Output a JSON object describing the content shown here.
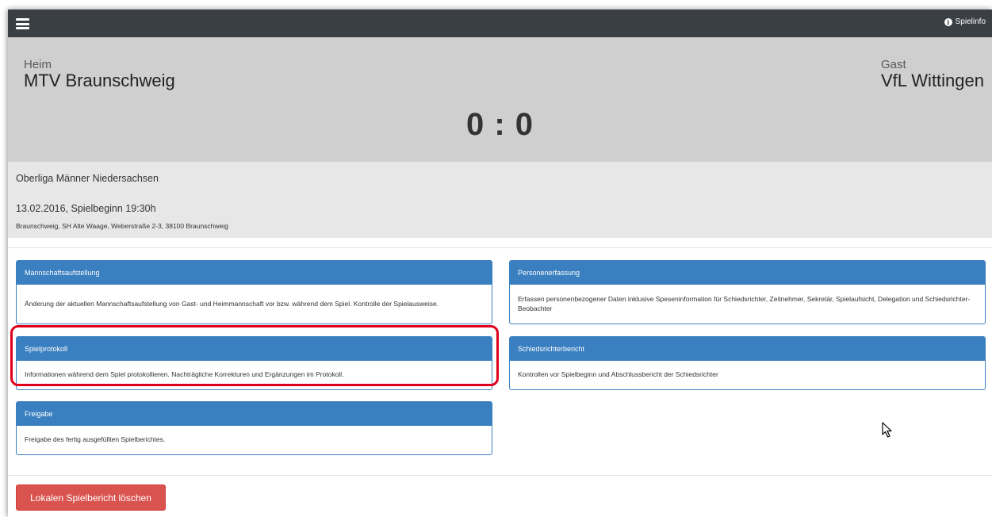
{
  "navbar": {
    "info_label": "Spielinfo",
    "menu_icon": "hamburger-menu-icon",
    "info_icon": "info-circle-icon"
  },
  "match": {
    "home_role": "Heim",
    "home_team": "MTV Braunschweig",
    "guest_role": "Gast",
    "guest_team": "VfL Wittingen",
    "score": "0 : 0"
  },
  "game_info": {
    "league": "Oberliga Männer Niedersachsen",
    "date_time": "13.02.2016, Spielbeginn 19:30h",
    "venue": "Braunschweig, SH Alte Waage, Weberstraße 2-3, 38100 Braunschweig"
  },
  "panels": [
    {
      "title": "Mannschaftsaufstellung",
      "description": "Änderung der aktuellen Mannschaftsaufstellung von Gast- und Heimmannschaft vor bzw. während dem Spiel. Kontrolle der Spielausweise."
    },
    {
      "title": "Personenerfassung",
      "description": "Erfassen personenbezogener Daten inklusive Speseninformation für Schiedsrichter, Zeitnehmer, Sekretär, Spielaufsicht, Delegation und Schiedsrichter-Beobachter"
    },
    {
      "title": "Spielprotokoll",
      "description": "Informationen während dem Spiel protokollieren. Nachträgliche Korrekturen und Ergänzungen im Protokoll."
    },
    {
      "title": "Schiedsrichterbericht",
      "description": "Kontrollen vor Spielbeginn und Abschlussbericht der Schiedsrichter"
    },
    {
      "title": "Freigabe",
      "description": "Freigabe des fertig ausgefüllten Spielberichtes."
    }
  ],
  "actions": {
    "delete_label": "Lokalen Spielbericht löschen"
  },
  "colors": {
    "navbar": "#3a3f44",
    "panel_primary": "#3a7fc0",
    "danger": "#d9534f",
    "highlight": "#e0001b"
  }
}
